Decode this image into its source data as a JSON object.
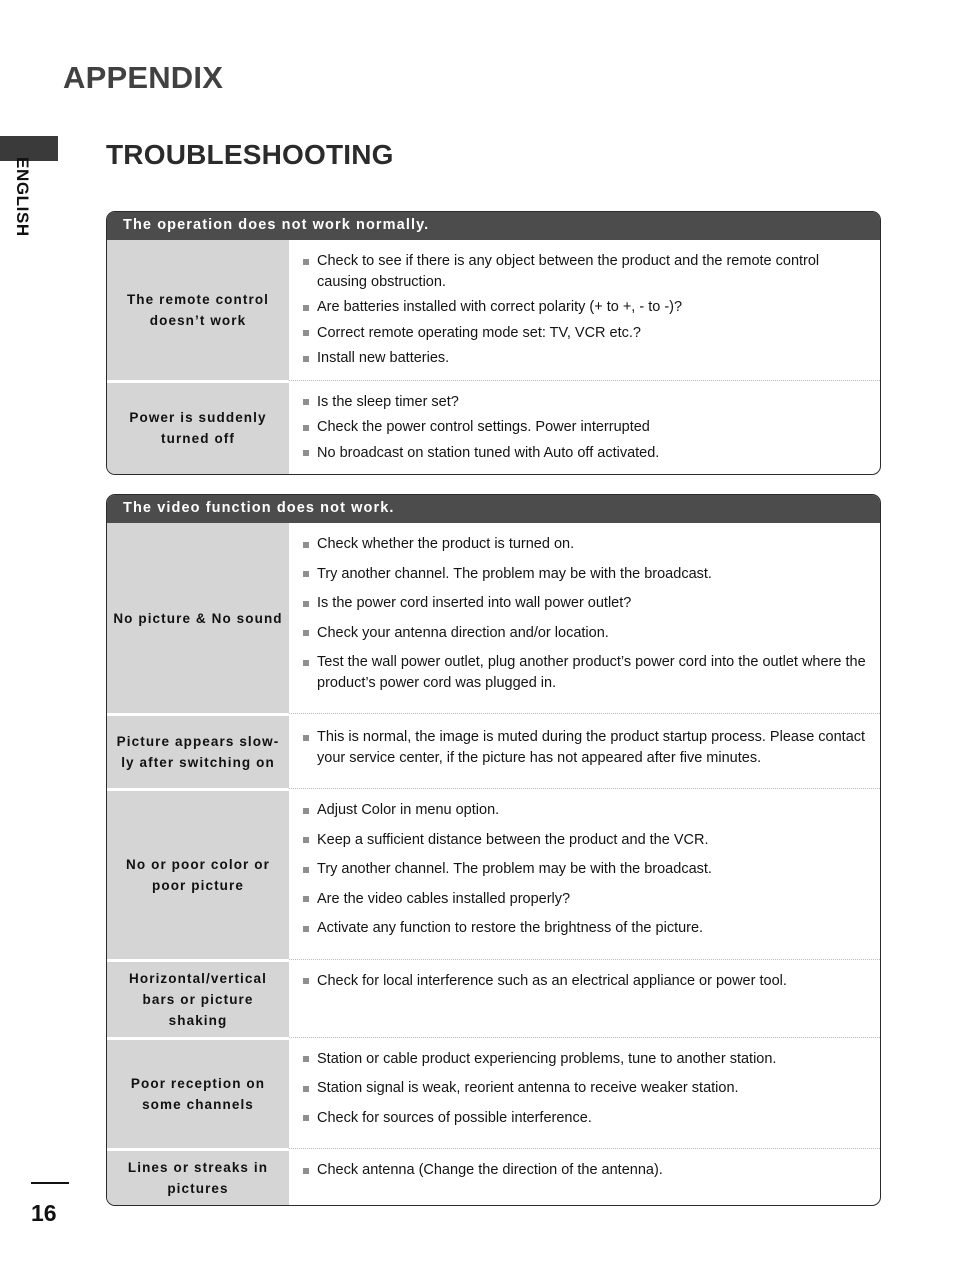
{
  "page": {
    "language_tab": "ENGLISH",
    "appendix_title": "APPENDIX",
    "section_title": "TROUBLESHOOTING",
    "page_number": "16"
  },
  "colors": {
    "table_header_bg": "#4c4c4c",
    "label_cell_bg": "#d5d5d5",
    "bullet_marker": "#8f8f8f",
    "border": "#2b2b2b",
    "tab_block": "#3a3a3a"
  },
  "tables": [
    {
      "header": "The operation does not work normally.",
      "rows": [
        {
          "label": "The remote control doesn’t work",
          "items": [
            "Check to see if there is any object between the product and the remote control causing obstruction.",
            "Are batteries installed with correct polarity (+ to +, - to -)?",
            "Correct remote operating mode set: TV, VCR etc.?",
            "Install new batteries."
          ]
        },
        {
          "label": "Power is suddenly turned off",
          "items": [
            "Is the sleep timer set?",
            "Check the power control settings. Power interrupted",
            "No broadcast on station tuned with Auto off activated."
          ]
        }
      ]
    },
    {
      "header": "The video function does not work.",
      "rows": [
        {
          "label": "No picture & No sound",
          "items": [
            "Check whether the product is turned on.",
            "Try another channel. The problem may be with the broadcast.",
            "Is the power cord inserted into wall power outlet?",
            "Check your antenna direction and/or location.",
            "Test the wall power outlet, plug another product’s power cord into the outlet where the product’s power cord was plugged in."
          ]
        },
        {
          "label": "Picture appears slow-ly after switching on",
          "items": [
            "This is normal, the image is muted during the product startup process. Please contact your service center, if the picture has not appeared after five minutes."
          ]
        },
        {
          "label": "No or poor color or poor picture",
          "items": [
            "Adjust Color in menu option.",
            "Keep a sufficient distance between the product and the VCR.",
            "Try another channel. The problem may be with the broadcast.",
            "Are the video cables installed properly?",
            "Activate any function to restore the brightness of the picture."
          ]
        },
        {
          "label": "Horizontal/vertical bars or picture shaking",
          "items": [
            "Check for local interference such as an electrical appliance or power tool."
          ]
        },
        {
          "label": "Poor reception on some channels",
          "items": [
            "Station or cable product experiencing problems, tune to another station.",
            "Station signal is weak, reorient antenna to receive weaker station.",
            "Check for sources of possible interference."
          ]
        },
        {
          "label": "Lines or streaks in pictures",
          "items": [
            "Check antenna (Change the direction of the antenna)."
          ]
        }
      ]
    }
  ]
}
